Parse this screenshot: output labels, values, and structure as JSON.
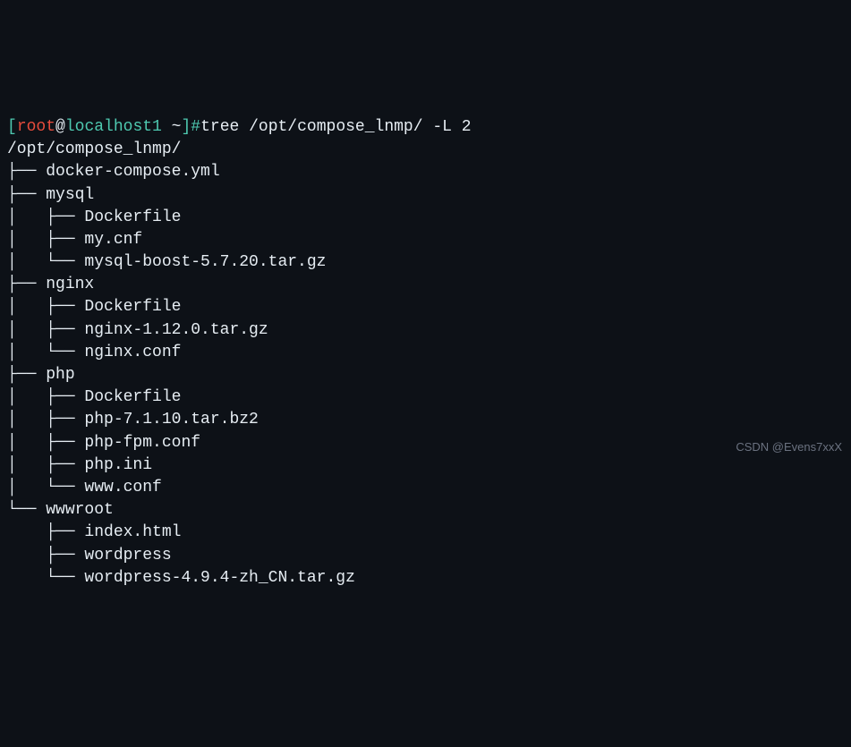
{
  "prompt": {
    "open": "[",
    "user": "root",
    "at": "@",
    "host": "localhost1",
    "path": " ~",
    "close": "]#",
    "command": "tree /opt/compose_lnmp/ ",
    "option": "-L 2"
  },
  "root_path": "/opt/compose_lnmp/",
  "tree": {
    "l1_prefix": "├── ",
    "l1_last": "└── ",
    "l2_prefix": "│   ├── ",
    "l2_last": "│   └── ",
    "l2_prefix_last": "    ├── ",
    "l2_last_last": "    └── ",
    "items": [
      {
        "name": "docker-compose.yml",
        "children": []
      },
      {
        "name": "mysql",
        "children": [
          {
            "name": "Dockerfile"
          },
          {
            "name": "my.cnf"
          },
          {
            "name": "mysql-boost-5.7.20.tar.gz"
          }
        ]
      },
      {
        "name": "nginx",
        "children": [
          {
            "name": "Dockerfile"
          },
          {
            "name": "nginx-1.12.0.tar.gz"
          },
          {
            "name": "nginx.conf"
          }
        ]
      },
      {
        "name": "php",
        "children": [
          {
            "name": "Dockerfile"
          },
          {
            "name": "php-7.1.10.tar.bz2"
          },
          {
            "name": "php-fpm.conf"
          },
          {
            "name": "php.ini"
          },
          {
            "name": "www.conf"
          }
        ]
      },
      {
        "name": "wwwroot",
        "children": [
          {
            "name": "index.html"
          },
          {
            "name": "wordpress"
          },
          {
            "name": "wordpress-4.9.4-zh_CN.tar.gz"
          }
        ]
      }
    ]
  },
  "watermark": "CSDN @Evens7xxX"
}
